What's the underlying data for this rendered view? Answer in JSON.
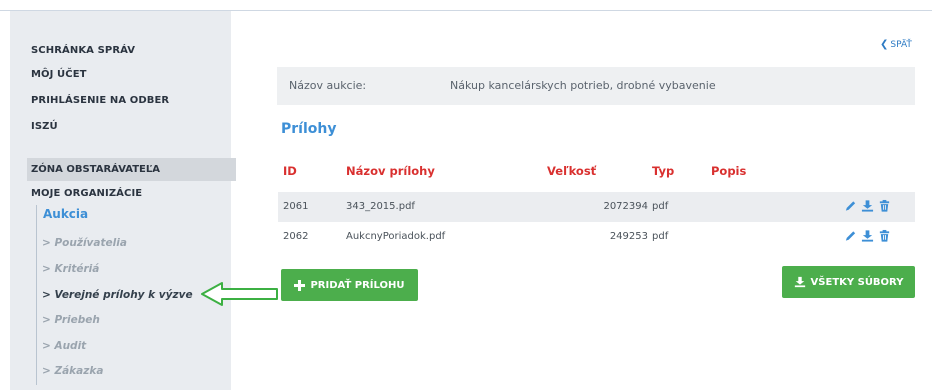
{
  "sidebar": {
    "menu": [
      "SCHRÁNKA SPRÁV",
      "MÔJ ÚČET",
      "PRIHLÁSENIE NA ODBER",
      "ISZÚ"
    ],
    "zone": "ZÓNA OBSTARÁVATEĽA",
    "org": "MOJE ORGANIZÁCIE",
    "active_section": "Aukcia",
    "sub_items": [
      "> Používatelia",
      "> Kritériá",
      "> Verejné prílohy k výzve",
      "> Priebeh",
      "> Audit",
      "> Zákazka"
    ]
  },
  "back_label": "SPÄŤ",
  "auction": {
    "label": "Názov aukcie:",
    "value": "Nákup kancelárskych potrieb, drobné vybavenie"
  },
  "section_title": "Prílohy",
  "table": {
    "headers": {
      "id": "ID",
      "name": "Názov prílohy",
      "size": "Veľkosť",
      "type": "Typ",
      "desc": "Popis"
    },
    "rows": [
      {
        "id": "2061",
        "name": "343_2015.pdf",
        "size": "2072394",
        "type": "pdf",
        "desc": ""
      },
      {
        "id": "2062",
        "name": "AukcnyPoriadok.pdf",
        "size": "249253",
        "type": "pdf",
        "desc": ""
      }
    ]
  },
  "buttons": {
    "add": "PRIDAŤ PRÍLOHU",
    "all": "VŠETKY SÚBORY"
  },
  "colors": {
    "accent_blue": "#3d8fd6",
    "header_red": "#d9302f",
    "button_green": "#4cae4c",
    "arrow_green": "#3cb043"
  },
  "icons": {
    "edit": "pencil-icon",
    "download": "download-icon",
    "delete": "trash-icon",
    "back": "chevron-left-icon",
    "add": "plus-icon"
  }
}
